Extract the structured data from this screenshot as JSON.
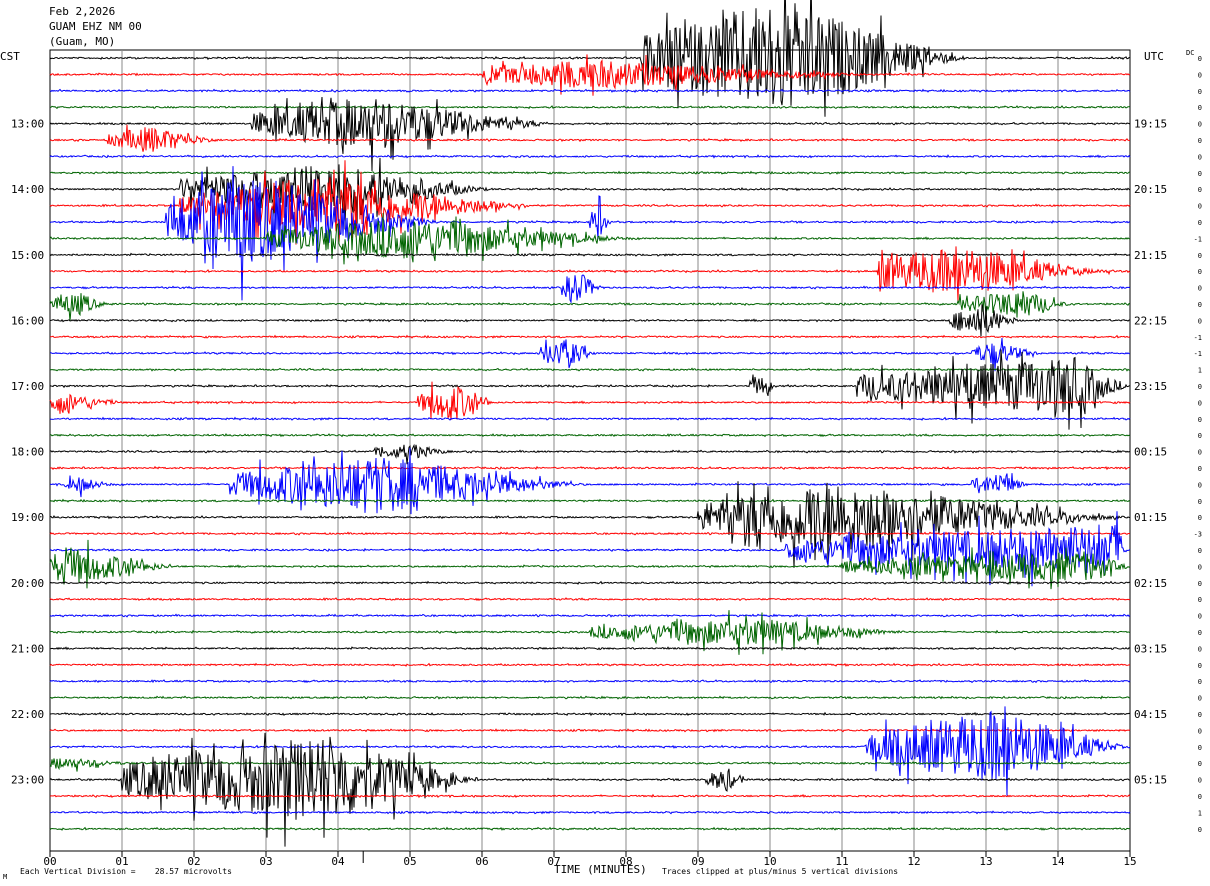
{
  "header": {
    "date": "Feb 2,2026",
    "station": "GUAM EHZ NM 00",
    "location": "(Guam, MO)"
  },
  "axes": {
    "left_timezone": "CST",
    "right_timezone": "UTC",
    "dc_label": "DC",
    "xlabel": "TIME (MINUTES)",
    "x_ticks": [
      "00",
      "01",
      "02",
      "03",
      "04",
      "05",
      "06",
      "07",
      "08",
      "09",
      "10",
      "11",
      "12",
      "13",
      "14",
      "15"
    ],
    "left_hour_labels": [
      "13:00",
      "14:00",
      "15:00",
      "16:00",
      "17:00",
      "18:00",
      "19:00",
      "20:00",
      "21:00",
      "22:00",
      "23:00"
    ],
    "right_hour_labels": [
      "19:15",
      "20:15",
      "21:15",
      "22:15",
      "23:15",
      "00:15",
      "01:15",
      "02:15",
      "03:15",
      "04:15",
      "05:15"
    ]
  },
  "footer": {
    "scale_note": "Each Vertical Division =    28.57 microvolts",
    "clip_note": "Traces clipped at plus/minus 5 vertical divisions",
    "corner_mark": "M"
  },
  "chart_data": {
    "type": "line",
    "title": "",
    "xlabel": "TIME (MINUTES)",
    "xlim": [
      0,
      15
    ],
    "trace_colors": [
      "#000000",
      "#ff0000",
      "#0000ff",
      "#006400"
    ],
    "minutes_per_trace": 15,
    "first_trace_start": "12:15",
    "dc_offsets": [
      0,
      0,
      0,
      0,
      0,
      0,
      0,
      0,
      0,
      0,
      0,
      -1,
      0,
      0,
      0,
      0,
      0,
      -1,
      -1,
      1,
      0,
      0,
      0,
      0,
      0,
      0,
      0,
      0,
      0,
      -3,
      0,
      0,
      0,
      0,
      0,
      0,
      0,
      0,
      0,
      0,
      0,
      0,
      0,
      0,
      0,
      0,
      1,
      0,
      0
    ],
    "events": [
      {
        "trace": 0,
        "start_min": 8.2,
        "end_min": 12.8,
        "peak_min": 10.2,
        "amplitude": 4.0
      },
      {
        "trace": 1,
        "start_min": 6.0,
        "end_min": 11.5,
        "peak_min": 7.5,
        "amplitude": 1.0
      },
      {
        "trace": 4,
        "start_min": 2.8,
        "end_min": 7.0,
        "peak_min": 4.5,
        "amplitude": 1.8
      },
      {
        "trace": 5,
        "start_min": 0.8,
        "end_min": 2.4,
        "peak_min": 1.4,
        "amplitude": 0.9
      },
      {
        "trace": 8,
        "start_min": 1.8,
        "end_min": 6.2,
        "peak_min": 4.0,
        "amplitude": 1.8
      },
      {
        "trace": 9,
        "start_min": 1.8,
        "end_min": 6.8,
        "peak_min": 3.8,
        "amplitude": 2.0
      },
      {
        "trace": 10,
        "start_min": 1.6,
        "end_min": 5.5,
        "peak_min": 2.6,
        "amplitude": 3.2
      },
      {
        "trace": 10,
        "start_min": 7.5,
        "end_min": 7.8,
        "peak_min": 7.6,
        "amplitude": 1.4
      },
      {
        "trace": 11,
        "start_min": 3.0,
        "end_min": 8.2,
        "peak_min": 5.0,
        "amplitude": 1.4
      },
      {
        "trace": 13,
        "start_min": 12.0,
        "end_min": 14.2,
        "peak_min": 12.9,
        "amplitude": 0.8
      },
      {
        "trace": 13,
        "start_min": 11.5,
        "end_min": 15.0,
        "peak_min": 11.0,
        "amplitude": 1.6
      },
      {
        "trace": 14,
        "start_min": 7.1,
        "end_min": 7.7,
        "peak_min": 7.3,
        "amplitude": 1.2
      },
      {
        "trace": 15,
        "start_min": 0.0,
        "end_min": 0.8,
        "peak_min": 0.4,
        "amplitude": 0.8
      },
      {
        "trace": 15,
        "start_min": 12.6,
        "end_min": 14.2,
        "peak_min": 13.5,
        "amplitude": 0.9
      },
      {
        "trace": 16,
        "start_min": 12.5,
        "end_min": 13.5,
        "peak_min": 12.9,
        "amplitude": 1.2
      },
      {
        "trace": 18,
        "start_min": 6.8,
        "end_min": 7.6,
        "peak_min": 7.2,
        "amplitude": 1.0
      },
      {
        "trace": 18,
        "start_min": 12.8,
        "end_min": 13.8,
        "peak_min": 13.1,
        "amplitude": 0.8
      },
      {
        "trace": 20,
        "start_min": 9.7,
        "end_min": 10.1,
        "peak_min": 9.9,
        "amplitude": 0.7
      },
      {
        "trace": 20,
        "start_min": 11.2,
        "end_min": 15.0,
        "peak_min": 14.2,
        "amplitude": 2.0
      },
      {
        "trace": 21,
        "start_min": 0.0,
        "end_min": 1.0,
        "peak_min": 0.1,
        "amplitude": 0.8
      },
      {
        "trace": 21,
        "start_min": 5.1,
        "end_min": 6.2,
        "peak_min": 5.6,
        "amplitude": 1.3
      },
      {
        "trace": 24,
        "start_min": 4.5,
        "end_min": 5.6,
        "peak_min": 5.0,
        "amplitude": 0.5
      },
      {
        "trace": 26,
        "start_min": 0.2,
        "end_min": 0.9,
        "peak_min": 0.4,
        "amplitude": 0.5
      },
      {
        "trace": 26,
        "start_min": 2.5,
        "end_min": 7.5,
        "peak_min": 4.5,
        "amplitude": 2.0
      },
      {
        "trace": 26,
        "start_min": 12.8,
        "end_min": 13.6,
        "peak_min": 13.2,
        "amplitude": 0.8
      },
      {
        "trace": 28,
        "start_min": 9.0,
        "end_min": 15.0,
        "peak_min": 10.8,
        "amplitude": 2.5
      },
      {
        "trace": 30,
        "start_min": 10.2,
        "end_min": 15.0,
        "peak_min": 14.8,
        "amplitude": 1.8
      },
      {
        "trace": 31,
        "start_min": 0.0,
        "end_min": 1.8,
        "peak_min": 0.2,
        "amplitude": 1.4
      },
      {
        "trace": 31,
        "start_min": 11.0,
        "end_min": 15.0,
        "peak_min": 14.5,
        "amplitude": 1.0
      },
      {
        "trace": 35,
        "start_min": 7.5,
        "end_min": 12.0,
        "peak_min": 9.8,
        "amplitude": 0.9
      },
      {
        "trace": 42,
        "start_min": 11.3,
        "end_min": 15.0,
        "peak_min": 13.2,
        "amplitude": 2.5
      },
      {
        "trace": 43,
        "start_min": 0.0,
        "end_min": 1.2,
        "peak_min": 0.1,
        "amplitude": 0.4
      },
      {
        "trace": 44,
        "start_min": 1.0,
        "end_min": 6.0,
        "peak_min": 3.9,
        "amplitude": 3.0
      },
      {
        "trace": 44,
        "start_min": 9.1,
        "end_min": 9.7,
        "peak_min": 9.4,
        "amplitude": 0.8
      }
    ]
  }
}
